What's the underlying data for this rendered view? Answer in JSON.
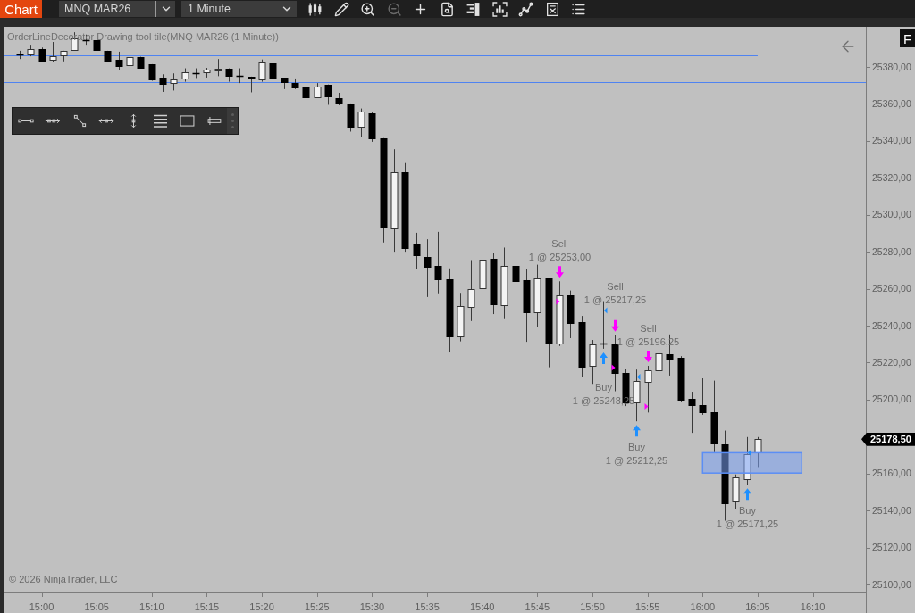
{
  "toolbar": {
    "window_tab": "Chart",
    "instrument": "MNQ MAR26",
    "interval": "1 Minute",
    "tools": [
      {
        "kind": "chart-style",
        "disabled": false
      },
      {
        "kind": "draw",
        "disabled": false
      },
      {
        "kind": "zoom-in",
        "disabled": false
      },
      {
        "kind": "zoom-out",
        "disabled": true
      },
      {
        "kind": "crosshair",
        "disabled": false
      },
      {
        "kind": "data-box",
        "disabled": false
      },
      {
        "kind": "ladder",
        "disabled": false
      },
      {
        "kind": "frame",
        "disabled": false
      },
      {
        "kind": "indicators",
        "disabled": false
      },
      {
        "kind": "strategies",
        "disabled": false
      },
      {
        "kind": "properties",
        "disabled": false
      }
    ]
  },
  "chart": {
    "title": "OrderLineDecorator Drawing tool tile(MNQ MAR26 (1 Minute))",
    "side_button": "F",
    "drawing_tools": [
      {
        "kind": "line"
      },
      {
        "kind": "ray"
      },
      {
        "kind": "diagonal"
      },
      {
        "kind": "horizontal"
      },
      {
        "kind": "vertical"
      },
      {
        "kind": "lines"
      },
      {
        "kind": "rectangle"
      },
      {
        "kind": "marker"
      }
    ],
    "executions": [
      {
        "kind": "sell",
        "label": "Sell",
        "text": "1 @ 25253,00"
      },
      {
        "kind": "sell",
        "label": "Sell",
        "text": "1 @ 25217,25"
      },
      {
        "kind": "sell",
        "label": "Sell",
        "text": "1 @ 25196,25"
      },
      {
        "kind": "buy",
        "label": "Buy",
        "text": "1 @ 25248,25"
      },
      {
        "kind": "buy",
        "label": "Buy",
        "text": "1 @ 25212,25"
      },
      {
        "kind": "buy",
        "label": "Buy",
        "text": "1 @ 25171,25"
      }
    ],
    "copyright": "© 2026 NinjaTrader, LLC",
    "price_axis": [
      {
        "kind": "tick",
        "label": "25380,00"
      },
      {
        "kind": "tick",
        "label": "25360,00"
      },
      {
        "kind": "tick",
        "label": "25340,00"
      },
      {
        "kind": "tick",
        "label": "25320,00"
      },
      {
        "kind": "tick",
        "label": "25300,00"
      },
      {
        "kind": "tick",
        "label": "25280,00"
      },
      {
        "kind": "tick",
        "label": "25260,00"
      },
      {
        "kind": "tick",
        "label": "25240,00"
      },
      {
        "kind": "tick",
        "label": "25220,00"
      },
      {
        "kind": "tick",
        "label": "25200,00"
      },
      {
        "kind": "last",
        "label": "25178,50"
      },
      {
        "kind": "tick",
        "label": "25160,00"
      },
      {
        "kind": "tick",
        "label": "25140,00"
      },
      {
        "kind": "tick",
        "label": "25120,00"
      },
      {
        "kind": "tick",
        "label": "25100,00"
      }
    ],
    "time_axis": [
      "15:00",
      "15:05",
      "15:10",
      "15:15",
      "15:20",
      "15:25",
      "15:30",
      "15:35",
      "15:40",
      "15:45",
      "15:50",
      "15:55",
      "16:00",
      "16:05",
      "16:10"
    ]
  }
}
